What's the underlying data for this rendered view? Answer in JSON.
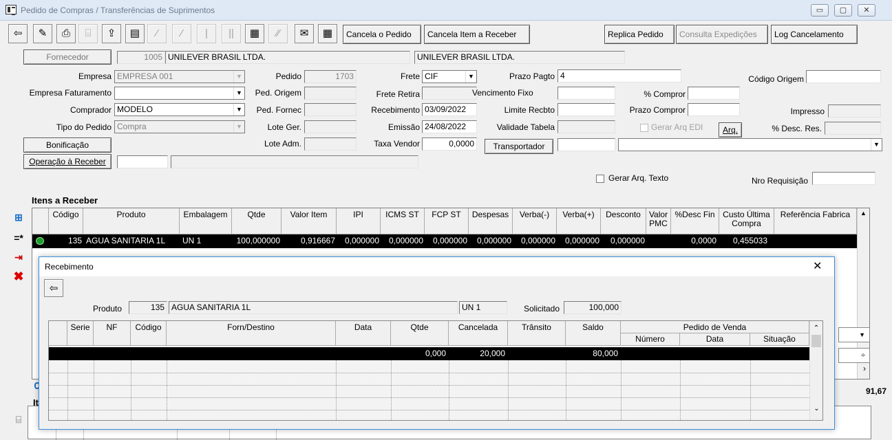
{
  "window": {
    "title": "Pedido de Compras / Transferências de Suprimentos"
  },
  "toolbar": {
    "cancel_order": "Cancela o Pedido",
    "cancel_item": "Cancela Item a Receber",
    "replicate": "Replica Pedido",
    "shipments": "Consulta Expedições",
    "cancel_log": "Log Cancelamento"
  },
  "header": {
    "supplier_button": "Fornecedor",
    "supplier_code": "1005",
    "supplier_name": "UNILEVER BRASIL LTDA.",
    "supplier_name2": "UNILEVER BRASIL LTDA.",
    "company_label": "Empresa",
    "company_value": "EMPRESA 001",
    "billing_company_label": "Empresa Faturamento",
    "billing_company_value": "",
    "buyer_label": "Comprador",
    "buyer_value": "MODELO",
    "order_type_label": "Tipo do Pedido",
    "order_type_value": "Compra",
    "bonus_button": "Bonificação",
    "op_receive_button": "Operação à Receber",
    "op_receive_value": "",
    "order_label": "Pedido",
    "order_value": "1703",
    "origin_order_label": "Ped. Origem",
    "supplier_order_label": "Ped. Fornec",
    "lot_gen_label": "Lote Ger.",
    "lot_adm_label": "Lote Adm.",
    "freight_label": "Frete",
    "freight_value": "CIF",
    "freight_pickup_label": "Frete Retira",
    "receipt_label": "Recebimento",
    "receipt_value": "03/09/2022",
    "issue_label": "Emissão",
    "issue_value": "24/08/2022",
    "vendor_rate_label": "Taxa Vendor",
    "vendor_rate_value": "0,0000",
    "payment_term_label": "Prazo Pagto",
    "payment_term_value": "4",
    "fixed_due_label": "Vencimento Fixo",
    "receipt_limit_label": "Limite Recbto",
    "table_validity_label": "Validade Tabela",
    "carrier_button": "Transportador",
    "pct_buy_label": "% Compror",
    "term_buy_label": "Prazo Compror",
    "edi_label": "Gerar Arq EDI",
    "arq_button": "Arq.",
    "origin_code_label": "Código Origem",
    "printed_label": "Impresso",
    "disc_res_label": "% Desc. Res.",
    "text_file_label": "Gerar Arq. Texto",
    "requisition_label": "Nro Requisição"
  },
  "items": {
    "title": "Itens a Receber",
    "columns": [
      "Código",
      "Produto",
      "Embalagem",
      "Qtde",
      "Valor Item",
      "IPI",
      "ICMS ST",
      "FCP ST",
      "Despesas",
      "Verba(-)",
      "Verba(+)",
      "Desconto",
      "Valor PMC",
      "%Desc Fin",
      "Custo Última Compra",
      "Referência Fabrica"
    ],
    "row": {
      "code": "135",
      "product": "AGUA SANITARIA 1L",
      "pack": "UN  1",
      "qty": "100,000000",
      "value": "0,916667",
      "ipi": "0,000000",
      "icms_st": "0,000000",
      "fcp_st": "0,000000",
      "expenses": "0,000000",
      "verba_minus": "0,000000",
      "verba_plus": "0,000000",
      "discount": "0,000000",
      "pmc": "",
      "disc_fin": "0,0000",
      "last_cost": "0,455033",
      "ref": ""
    },
    "total": "91,67",
    "second_title": "It"
  },
  "dialog": {
    "title": "Recebimento",
    "product_label": "Produto",
    "product_code": "135",
    "product_name": "AGUA SANITARIA 1L",
    "unit": "UN  1",
    "requested_label": "Solicitado",
    "requested_value": "100,000",
    "columns": [
      "Serie",
      "NF",
      "Código",
      "Forn/Destino",
      "Data",
      "Qtde",
      "Cancelada",
      "Trânsito",
      "Saldo"
    ],
    "group_header": "Pedido de Venda",
    "sub_columns": [
      "Número",
      "Data",
      "Situação"
    ],
    "row": {
      "qty": "0,000",
      "cancelled": "20,000",
      "balance": "80,000"
    }
  }
}
